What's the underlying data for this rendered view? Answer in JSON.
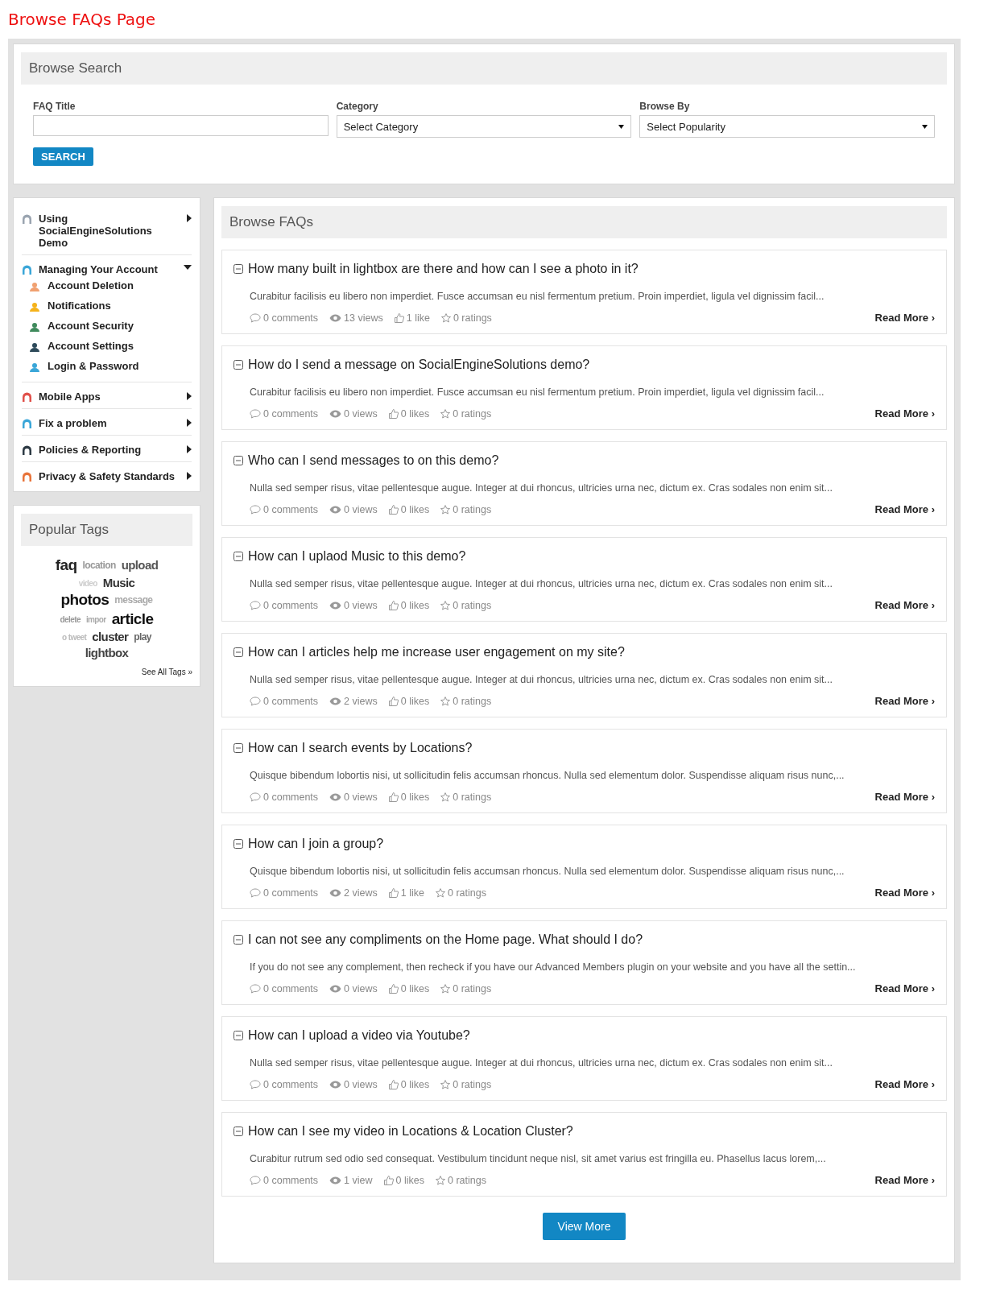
{
  "page_title": "Browse FAQs Page",
  "search": {
    "heading": "Browse Search",
    "fields": [
      {
        "kind": "text",
        "label": "FAQ Title"
      },
      {
        "kind": "select",
        "label": "Category",
        "value": "Select Category"
      },
      {
        "kind": "select",
        "label": "Browse By",
        "value": "Select Popularity"
      }
    ],
    "button": "SEARCH"
  },
  "categories": [
    {
      "label": "Using SocialEngineSolutions Demo",
      "expanded": false,
      "color": "#9aa4b0"
    },
    {
      "label": "Managing Your Account",
      "expanded": true,
      "color": "#3aa6d8",
      "children": [
        {
          "label": "Account Deletion",
          "color": "#f0a070"
        },
        {
          "label": "Notifications",
          "color": "#f5b21a"
        },
        {
          "label": "Account Security",
          "color": "#3f8a5c"
        },
        {
          "label": "Account Settings",
          "color": "#2d4a5a"
        },
        {
          "label": "Login & Password",
          "color": "#3aa6d8"
        }
      ]
    },
    {
      "label": "Mobile Apps",
      "expanded": false,
      "color": "#e0504a"
    },
    {
      "label": "Fix a problem",
      "expanded": false,
      "color": "#3aa6d8"
    },
    {
      "label": "Policies & Reporting",
      "expanded": false,
      "color": "#2d3a44"
    },
    {
      "label": "Privacy & Safety Standards",
      "expanded": false,
      "color": "#e8743a"
    }
  ],
  "tags": {
    "heading": "Popular Tags",
    "items": [
      {
        "label": "faq",
        "kind": "xl",
        "color": "#222222"
      },
      {
        "label": "location",
        "kind": "m",
        "color": "#999999"
      },
      {
        "label": "upload",
        "kind": "l",
        "color": "#555555"
      },
      {
        "label": "video",
        "kind": "s",
        "color": "#cccccc"
      },
      {
        "label": "Music",
        "kind": "l",
        "color": "#333333"
      },
      {
        "label": "photos",
        "kind": "xl",
        "color": "#111111"
      },
      {
        "label": "message",
        "kind": "m",
        "color": "#aaaaaa"
      },
      {
        "label": "delete",
        "kind": "s",
        "color": "#999999"
      },
      {
        "label": "impor",
        "kind": "s",
        "color": "#aaaaaa"
      },
      {
        "label": "article",
        "kind": "xl",
        "color": "#111111"
      },
      {
        "label": "o tweet",
        "kind": "s",
        "color": "#bbbbbb"
      },
      {
        "label": "cluster",
        "kind": "l",
        "color": "#333333"
      },
      {
        "label": "play",
        "kind": "m",
        "color": "#666666"
      },
      {
        "label": "lightbox",
        "kind": "l",
        "color": "#444444"
      }
    ],
    "see_all": "See All Tags »"
  },
  "faqs": {
    "heading": "Browse FAQs",
    "items": [
      {
        "title": "How many built in lightbox are there and how can I see a photo in it?",
        "excerpt": "Curabitur facilisis eu libero non imperdiet. Fusce accumsan eu nisl fermentum pretium. Proin imperdiet, ligula vel dignissim facil...",
        "comments": "0 comments",
        "views": "13 views",
        "likes": "1 like",
        "ratings": "0 ratings",
        "read_more": "Read More ›"
      },
      {
        "title": "How do I send a message on SocialEngineSolutions demo?",
        "excerpt": "Curabitur facilisis eu libero non imperdiet. Fusce accumsan eu nisl fermentum pretium. Proin imperdiet, ligula vel dignissim facil...",
        "comments": "0 comments",
        "views": "0 views",
        "likes": "0 likes",
        "ratings": "0 ratings",
        "read_more": "Read More ›"
      },
      {
        "title": "Who can I send messages to on this demo?",
        "excerpt": "Nulla sed semper risus, vitae pellentesque augue. Integer at dui rhoncus, ultricies urna nec, dictum ex. Cras sodales non enim sit...",
        "comments": "0 comments",
        "views": "0 views",
        "likes": "0 likes",
        "ratings": "0 ratings",
        "read_more": "Read More ›"
      },
      {
        "title": "How can I uplaod Music to this demo?",
        "excerpt": "Nulla sed semper risus, vitae pellentesque augue. Integer at dui rhoncus, ultricies urna nec, dictum ex. Cras sodales non enim sit...",
        "comments": "0 comments",
        "views": "0 views",
        "likes": "0 likes",
        "ratings": "0 ratings",
        "read_more": "Read More ›"
      },
      {
        "title": "How can I articles help me increase user engagement on my site?",
        "excerpt": "Nulla sed semper risus, vitae pellentesque augue. Integer at dui rhoncus, ultricies urna nec, dictum ex. Cras sodales non enim sit...",
        "comments": "0 comments",
        "views": "2 views",
        "likes": "0 likes",
        "ratings": "0 ratings",
        "read_more": "Read More ›"
      },
      {
        "title": "How can I search events by Locations?",
        "excerpt": "Quisque bibendum lobortis nisi, ut sollicitudin felis accumsan rhoncus. Nulla sed elementum dolor. Suspendisse aliquam risus nunc,...",
        "comments": "0 comments",
        "views": "0 views",
        "likes": "0 likes",
        "ratings": "0 ratings",
        "read_more": "Read More ›"
      },
      {
        "title": "How can I join a group?",
        "excerpt": "Quisque bibendum lobortis nisi, ut sollicitudin felis accumsan rhoncus. Nulla sed elementum dolor. Suspendisse aliquam risus nunc,...",
        "comments": "0 comments",
        "views": "2 views",
        "likes": "1 like",
        "ratings": "0 ratings",
        "read_more": "Read More ›"
      },
      {
        "title": "I can not see any compliments on the Home page. What should I do?",
        "excerpt": "If you do not see any complement, then recheck if you have our Advanced Members plugin on your website and you have all the settin...",
        "comments": "0 comments",
        "views": "0 views",
        "likes": "0 likes",
        "ratings": "0 ratings",
        "read_more": "Read More ›"
      },
      {
        "title": "How can I upload a video via Youtube?",
        "excerpt": "Nulla sed semper risus, vitae pellentesque augue. Integer at dui rhoncus, ultricies urna nec, dictum ex. Cras sodales non enim sit...",
        "comments": "0 comments",
        "views": "0 views",
        "likes": "0 likes",
        "ratings": "0 ratings",
        "read_more": "Read More ›"
      },
      {
        "title": "How can I see my video in Locations & Location Cluster?",
        "excerpt": "Curabitur rutrum sed odio sed consequat. Vestibulum tincidunt neque nisl, sit amet varius est fringilla eu. Phasellus lacus lorem,...",
        "comments": "0 comments",
        "views": "1 view",
        "likes": "0 likes",
        "ratings": "0 ratings",
        "read_more": "Read More ›"
      }
    ],
    "view_more": "View More"
  }
}
